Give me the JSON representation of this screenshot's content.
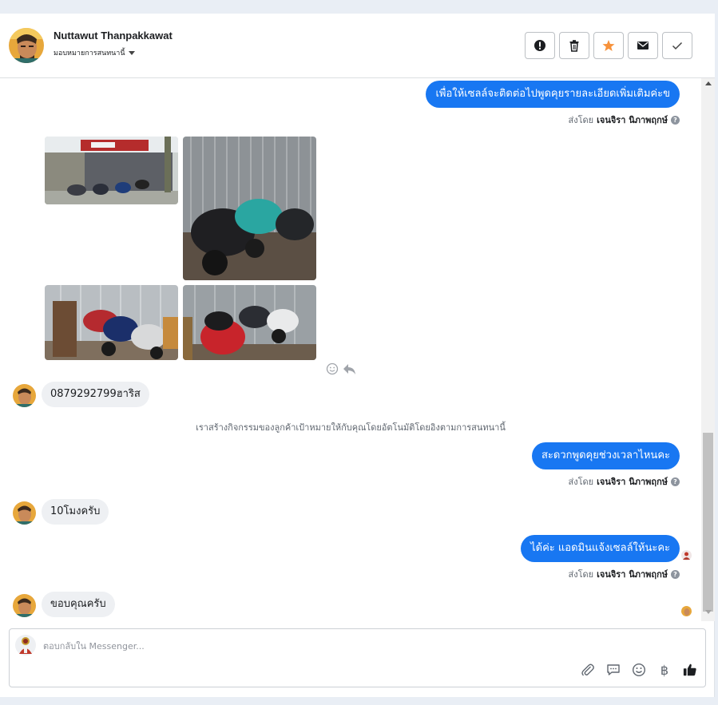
{
  "header": {
    "contact_name": "Nuttawut Thanpakkawat",
    "assign_label": "มอบหมายการสนทนานี้"
  },
  "messages": {
    "out_1": "เพื่อให้เซลล์จะติดต่อไปพูดคุยรายละเอียดเพิ่มเติมค่ะข",
    "out_2": "สะดวกพูดคุยช่วงเวลาไหนคะ",
    "out_3": "ได้ค่ะ แอดมินแจ้งเซลล์ให้นะคะ",
    "in_1": "0879292799ฮาริส",
    "in_2": "10โมงครับ",
    "in_3": "ขอบคุณครับ",
    "sent_by_prefix": "ส่งโดย",
    "sender_name": "เจนจิรา นิภาพฤกษ์",
    "system_note": "เราสร้างกิจกรรมของลูกค้าเป้าหมายให้กับคุณโดยอัตโนมัติโดยอิงตามการสนทนานี้"
  },
  "composer": {
    "placeholder": "ตอบกลับใน Messenger...",
    "currency_symbol": "฿"
  },
  "colors": {
    "accent": "#1877f2",
    "incoming_bubble": "#eef0f3",
    "star": "#f7923b"
  }
}
